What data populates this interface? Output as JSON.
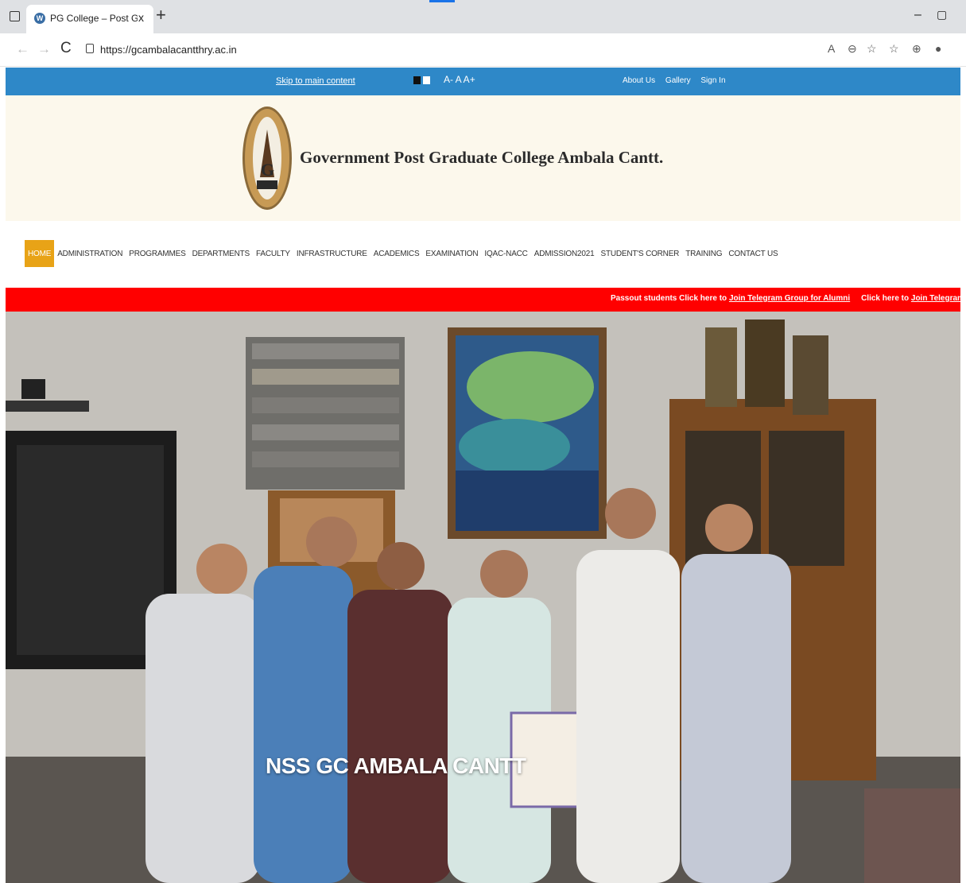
{
  "browser": {
    "tab_title": "PG College – Post Graduate colle",
    "tab_close": "x",
    "new_tab": "+",
    "url": "https://gcambalacantthry.ac.in",
    "back": "←",
    "forward": "→",
    "reload": "C",
    "minimize": "–",
    "restore": "▢",
    "tools": [
      "A",
      "⊖",
      "☆",
      "☆",
      "⊕",
      "●"
    ]
  },
  "topstrip": {
    "skip_link": "Skip to main content",
    "font_controls": "A- A A+",
    "links": [
      "About Us",
      "Gallery",
      "Sign In"
    ],
    "color": "#2e88c8"
  },
  "header": {
    "college_name": "Government Post Graduate College Ambala Cantt.",
    "logo_letter": "G"
  },
  "nav": {
    "items": [
      "HOME",
      "ADMINISTRATION",
      "PROGRAMMES",
      "DEPARTMENTS",
      "FACULTY",
      "INFRASTRUCTURE",
      "ACADEMICS",
      "EXAMINATION",
      "IQAC-NACC",
      "ADMISSION2021",
      "STUDENT'S CORNER",
      "TRAINING",
      "CONTACT US"
    ],
    "active": "HOME",
    "active_color": "#e8a317"
  },
  "ticker": {
    "prefix1": "Passout students Click here to ",
    "link1": "Join Telegram Group for Alumni",
    "prefix2": "Click here to ",
    "link2": "Join Telegram Group of Govt College Ambala Cant",
    "color": "#ff0000"
  },
  "hero": {
    "caption": "NSS GC AMBALA CANTT"
  }
}
